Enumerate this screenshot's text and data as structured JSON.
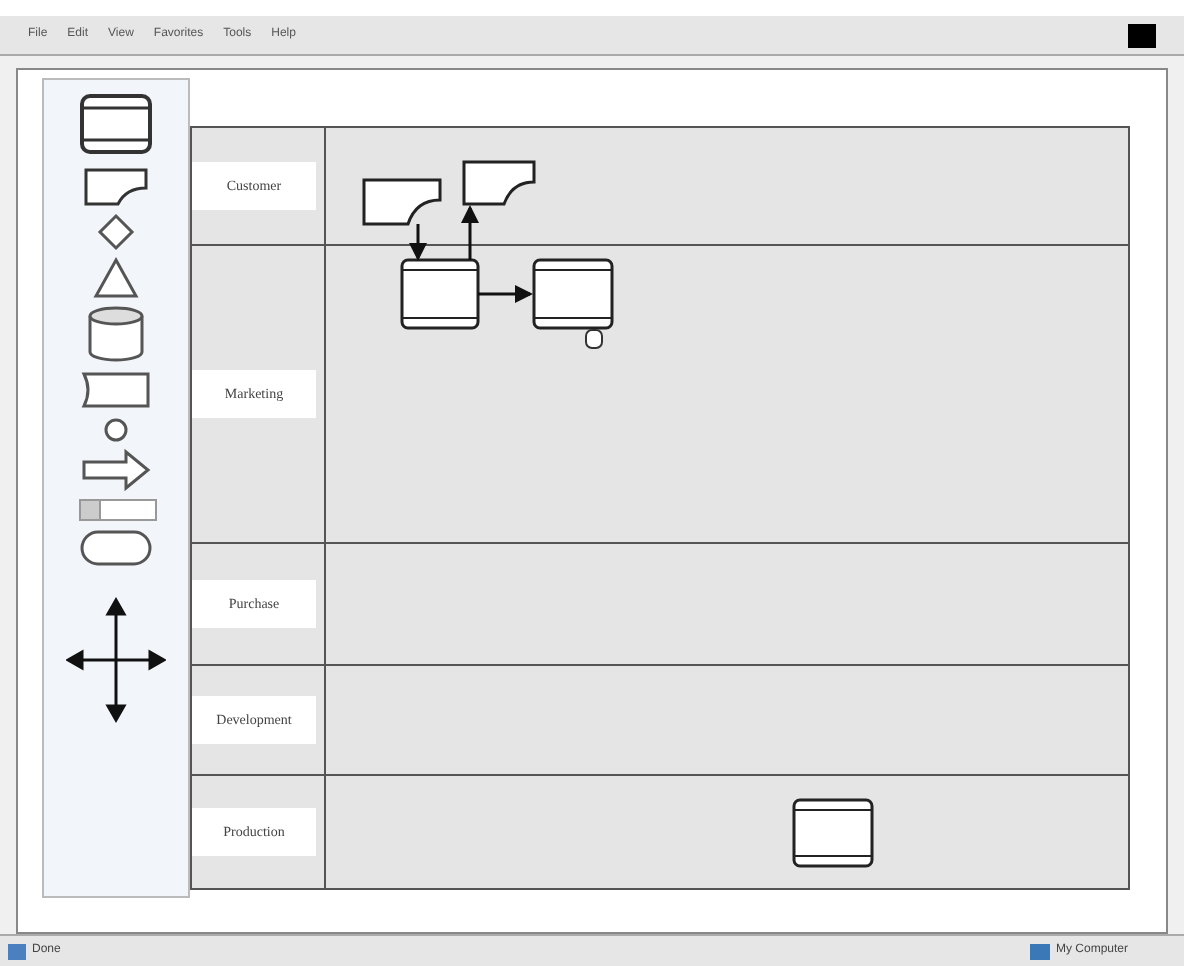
{
  "menu_bar": {
    "items": [
      "File",
      "Edit",
      "View",
      "Favorites",
      "Tools",
      "Help"
    ]
  },
  "lanes": [
    {
      "label": "Customer"
    },
    {
      "label": "Marketing"
    },
    {
      "label": "Purchase"
    },
    {
      "label": "Development"
    },
    {
      "label": "Production"
    }
  ],
  "status_bar": {
    "status": "Done",
    "zone": "My Computer"
  }
}
